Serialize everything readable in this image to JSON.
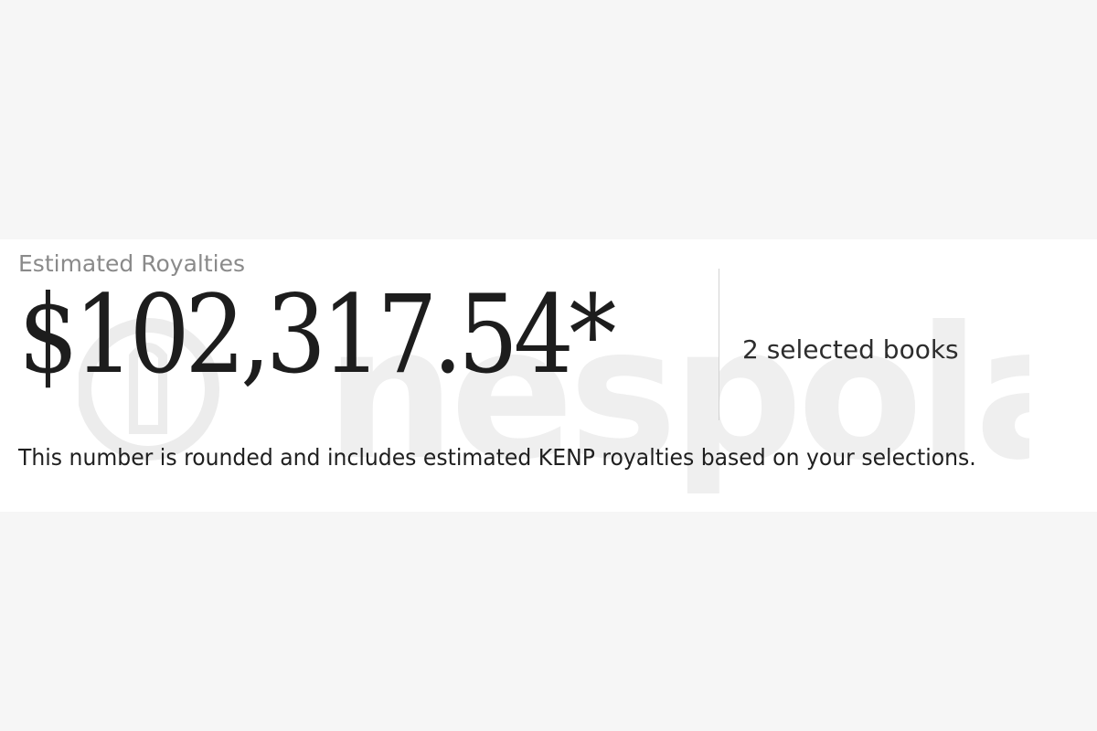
{
  "royalties": {
    "label": "Estimated Royalties",
    "amount": "$102,317.54*",
    "selected_books": "2 selected books",
    "note": "This number is rounded and includes estimated KENP royalties based on your selections."
  },
  "watermark": {
    "text": "nespola"
  },
  "colors": {
    "background": "#f6f6f6",
    "panel": "#ffffff",
    "label": "#8a8a8a",
    "amount": "#1d1d1d",
    "divider": "#d3d3d3"
  }
}
